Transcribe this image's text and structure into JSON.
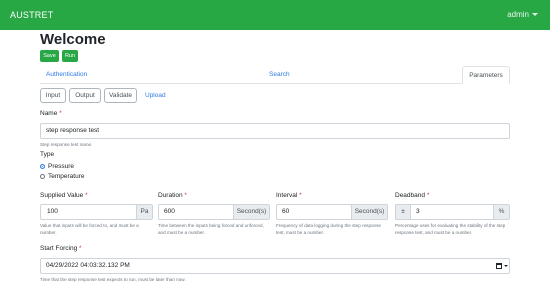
{
  "app": {
    "brand": "AUSTRET",
    "user": "admin"
  },
  "page": {
    "title": "Welcome"
  },
  "actions": {
    "save": "Save",
    "run": "Run"
  },
  "tabs": [
    {
      "label": "Authentication",
      "active": false
    },
    {
      "label": "Search",
      "active": false
    },
    {
      "label": "Parameters",
      "active": true
    }
  ],
  "subtabs": {
    "input": "Input",
    "output": "Output",
    "validate": "Validate",
    "upload": "Upload"
  },
  "form": {
    "name": {
      "label": "Name",
      "required": "*",
      "value": "step response test",
      "help": "Step response test name."
    },
    "type": {
      "label": "Type",
      "options": [
        {
          "label": "Pressure",
          "checked": true
        },
        {
          "label": "Temperature",
          "checked": false
        }
      ]
    },
    "supplied_value": {
      "label": "Supplied Value",
      "required": "*",
      "value": "100",
      "unit": "Pa",
      "help": "Value that inputs will be forced to, and must be a number."
    },
    "duration": {
      "label": "Duration",
      "required": "*",
      "value": "600",
      "unit": "Second(s)",
      "help": "Time between the inputs being forced and unforced, and must be a number."
    },
    "interval": {
      "label": "Interval",
      "required": "*",
      "value": "60",
      "unit": "Second(s)",
      "help": "Frequency of data logging during the step response test, must be a number."
    },
    "deadband": {
      "label": "Deadband",
      "required": "*",
      "prefix": "±",
      "value": "3",
      "unit": "%",
      "help": "Percentage uses for evaluating the stability of the step response test, and must be a number."
    },
    "start_forcing": {
      "label": "Start Forcing",
      "required": "*",
      "value": "04/29/2022 04:03:32.132 PM",
      "help": "Time that the step response test expects to run, must be later than now."
    }
  },
  "colors": {
    "brand_green": "#28a745",
    "link_blue": "#2c7be5",
    "required_red": "#dc3545"
  }
}
